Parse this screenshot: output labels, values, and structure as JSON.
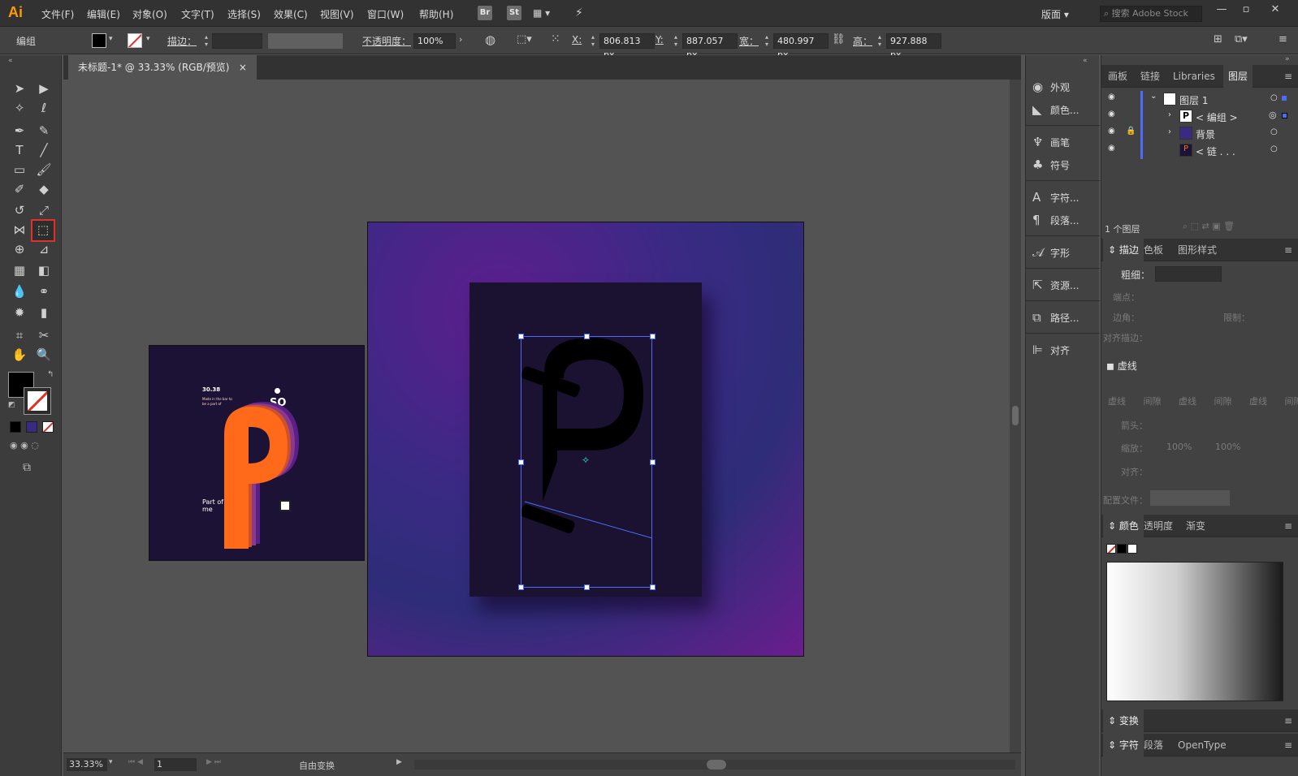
{
  "app": {
    "logo": "Ai"
  },
  "menu": [
    "文件(F)",
    "编辑(E)",
    "对象(O)",
    "文字(T)",
    "选择(S)",
    "效果(C)",
    "视图(V)",
    "窗口(W)",
    "帮助(H)"
  ],
  "appbar": {
    "br": "Br",
    "st": "St",
    "workspace": "版面",
    "search_placeholder": "搜索 Adobe Stock"
  },
  "control": {
    "selection": "编组",
    "stroke_label": "描边：",
    "opacity_label": "不透明度：",
    "opacity": "100%",
    "x_label": "X:",
    "x": "806.813 px",
    "y_label": "Y:",
    "y": "887.057 px",
    "w_label": "宽：",
    "w": "480.997 px",
    "h_label": "高：",
    "h": "927.888 px"
  },
  "doc": {
    "tab_title": "未标题-1* @ 33.33% (RGB/预览)",
    "close": "×"
  },
  "status": {
    "zoom": "33.33%",
    "page": "1",
    "tool": "自由变换"
  },
  "poster": {
    "date": "30.38",
    "tagline": "Made in the bar to be a part of",
    "brand": "SO",
    "footer": "Part of me"
  },
  "midpanel": [
    "外观",
    "颜色...",
    "画笔",
    "符号",
    "字符...",
    "段落...",
    "字形",
    "资源...",
    "路径...",
    "对齐"
  ],
  "panel1": {
    "tabs": [
      "画板",
      "链接",
      "Libraries",
      "图层"
    ],
    "active": "图层",
    "layers": [
      {
        "name": "图层 1"
      },
      {
        "name": "< 编组 >"
      },
      {
        "name": "背景"
      },
      {
        "name": "< 链 . . ."
      }
    ],
    "count": "1 个图层"
  },
  "panel2": {
    "tabs": [
      "描边",
      "色板",
      "图形样式"
    ],
    "weight_label": "粗细：",
    "cap_label": "端点：",
    "corner_label": "边角：",
    "limit_label": "限制：",
    "align_label": "对齐描边：",
    "dashed": "虚线",
    "dash_labels": [
      "虚线",
      "间隙",
      "虚线",
      "间隙",
      "虚线",
      "间隙"
    ],
    "arrow_label": "箭头：",
    "scale_label": "缩放：",
    "scale1": "100%",
    "scale2": "100%",
    "align2_label": "对齐：",
    "profile_label": "配置文件："
  },
  "panel3": {
    "tabs": [
      "颜色",
      "透明度",
      "渐变"
    ]
  },
  "panel4": {
    "title": "变换"
  },
  "panel5": {
    "tabs": [
      "字符",
      "段落",
      "OpenType"
    ]
  },
  "colors": {
    "accent": "#ff6a1a",
    "purple": "#5a2088",
    "selection": "#4a6cf7"
  }
}
